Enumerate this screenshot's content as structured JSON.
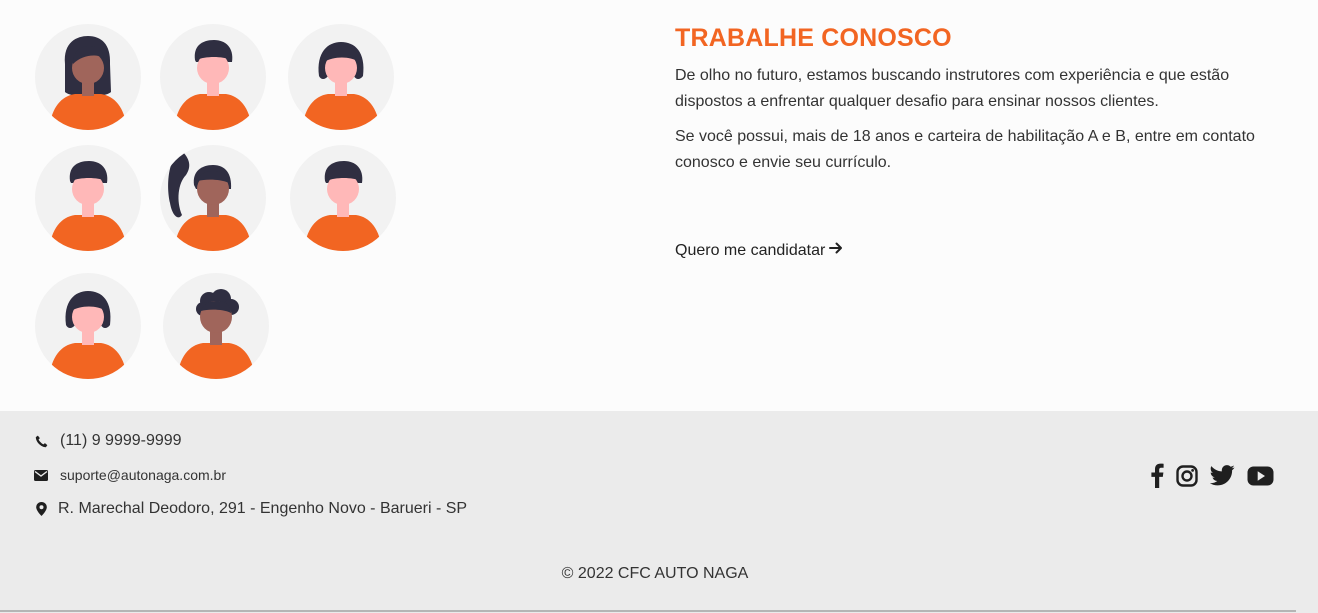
{
  "join_section": {
    "title": "TRABALHE CONOSCO",
    "paragraph_1": "De olho no futuro, estamos buscando instrutores com experiência e que estão dispostos a enfrentar qualquer desafio para ensinar nossos clientes.",
    "paragraph_2": "Se você possui, mais de 18 anos e carteira de habilitação A e B, entre em contato conosco e envie seu currículo.",
    "cta_label": "Quero me candidatar",
    "cta_icon": "arrow-right-icon",
    "avatars": [
      {
        "skin": "#a0655b",
        "hair": "#2f2e41",
        "style": "long"
      },
      {
        "skin": "#ffb8b8",
        "hair": "#2f2e41",
        "style": "short"
      },
      {
        "skin": "#ffb8b8",
        "hair": "#2f2e41",
        "style": "bob"
      },
      {
        "skin": "#ffb8b8",
        "hair": "#2f2e41",
        "style": "short"
      },
      {
        "skin": "#a0655b",
        "hair": "#2f2e41",
        "style": "ponytail"
      },
      {
        "skin": "#ffb8b8",
        "hair": "#2f2e41",
        "style": "short"
      },
      {
        "skin": "#ffb8b8",
        "hair": "#2f2e41",
        "style": "bob"
      },
      {
        "skin": "#a0655b",
        "hair": "#2f2e41",
        "style": "curly"
      }
    ]
  },
  "footer": {
    "phone": "(11) 9 9999-9999",
    "phone_icon": "phone-icon",
    "email": "suporte@autonaga.com.br",
    "email_icon": "envelope-icon",
    "address": "R. Marechal Deodoro, 291 - Engenho Novo - Barueri - SP",
    "address_icon": "map-marker-icon",
    "social": [
      "facebook-icon",
      "instagram-icon",
      "twitter-icon",
      "youtube-icon"
    ],
    "copyright": "© 2022 CFC AUTO NAGA"
  },
  "colors": {
    "accent": "#f26522",
    "avatar_bg": "#f2f2f2",
    "footer_bg": "#ebebeb",
    "hair": "#2f2e41"
  }
}
